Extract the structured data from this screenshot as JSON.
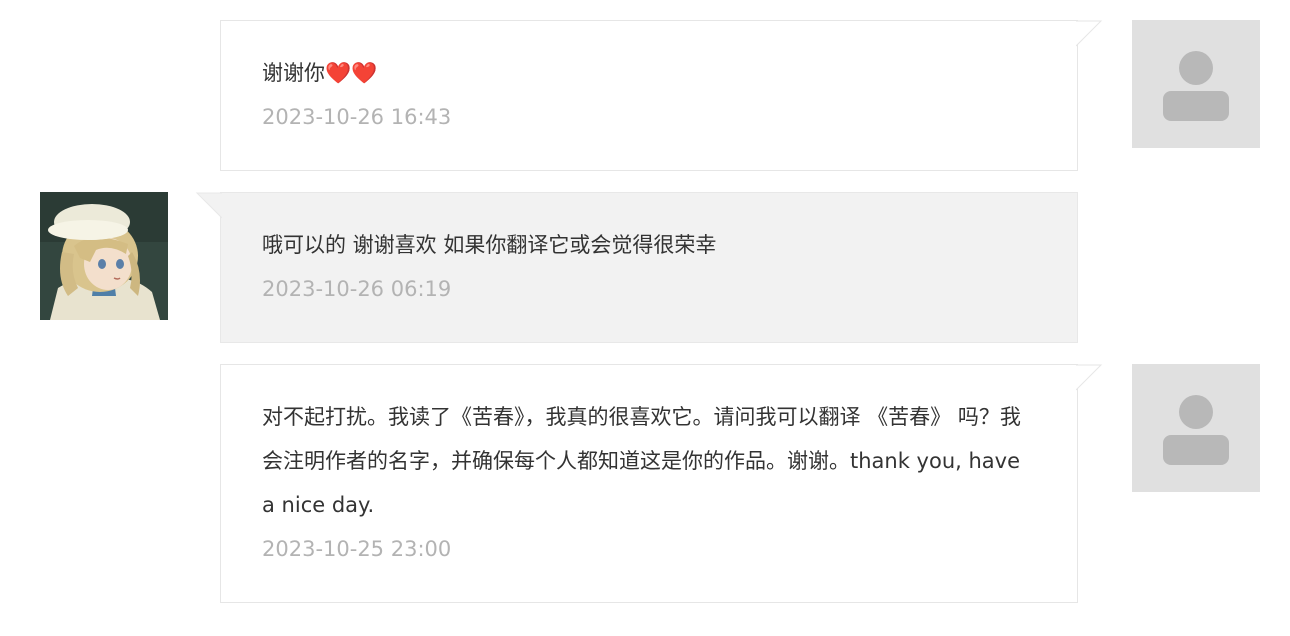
{
  "messages": [
    {
      "text": "谢谢你❤️❤️",
      "time": "2023-10-26 16:43"
    },
    {
      "text": "哦可以的 谢谢喜欢 如果你翻译它或会觉得很荣幸",
      "time": "2023-10-26 06:19"
    },
    {
      "text": "对不起打扰。我读了《苦春》，我真的很喜欢它。请问我可以翻译 《苦春》 吗？我会注明作者的名字，并确保每个人都知道这是你的作品。谢谢。thank you, have a nice day.",
      "time": "2023-10-25 23:00"
    }
  ],
  "colors": {
    "text": "#333333",
    "time": "#b3b3b3",
    "theirs_bg": "#f2f2f2",
    "mine_bg": "#ffffff",
    "border": "#e6e6e6",
    "default_avatar_bg": "#e0e0e0",
    "default_avatar_fg": "#b8b8b8"
  }
}
